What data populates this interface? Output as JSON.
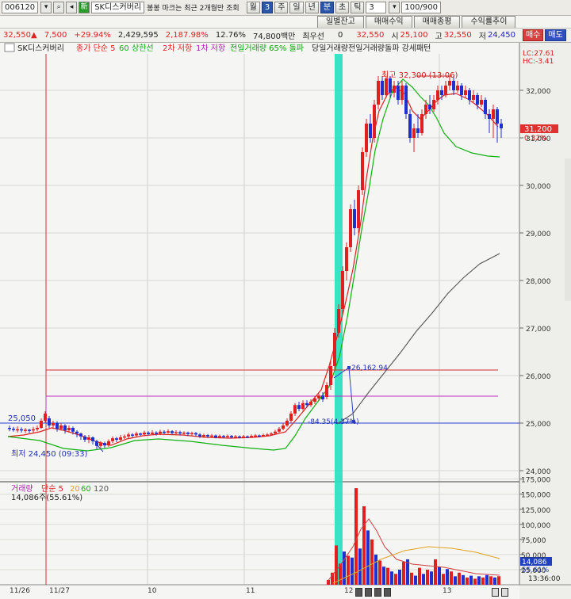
{
  "toolbar1": {
    "code": "006120",
    "name": "SK디스커버리",
    "notice": "봉봉 마크는 최근 2개월만 조회",
    "period_tabs": [
      "월",
      "3",
      "주",
      "일",
      "년",
      "분",
      "초",
      "틱"
    ],
    "active_tab": "분",
    "interval": "3",
    "count": "100/900",
    "tab_buttons": [
      "일별잔고",
      "매매수익",
      "매매종평",
      "수익률추이"
    ]
  },
  "quote_bar": {
    "price": "32,550",
    "change": "7,500",
    "change_pct": "+29.94%",
    "volume": "2,429,595",
    "volume_ratio": "2,187.98%",
    "turnover": "12.76%",
    "amount": "74,800백만",
    "pref_label": "최우선",
    "zero": "0",
    "last": "32,550",
    "open_label": "시",
    "open": "25,100",
    "high_label": "고",
    "high": "32,550",
    "low_label": "저",
    "low": "24,450",
    "buy_label": "매수",
    "sell_label": "매도"
  },
  "legend_bar": {
    "name": "SK디스커버리",
    "ma_label": "종가 단순 5",
    "ma60": "60",
    "upper_limit": "상한선",
    "resist2": "2차 저항",
    "resist1": "1차 저항",
    "prev_vol": "전일거래량 65% 돌파",
    "pattern": "당일거래량전일거래량돌파 강세패턴"
  },
  "price_panel": {
    "lc_label": "LC:27.61",
    "hc_label": "HC:-3.41",
    "y_ticks": [
      "32,000",
      "31,000",
      "30,000",
      "29,000",
      "28,000",
      "27,000",
      "26,000",
      "25,000",
      "24,000"
    ],
    "current_price": "31,200",
    "current_pct": "0.32%",
    "left_value": "25,050",
    "high_annotation": "최고 32,300 (13:06)",
    "low_annotation": "최저 24,450 (09:33)",
    "mid_annotation": "26,162.94",
    "diff_annotation": "-84.35(4.37%)"
  },
  "volume_panel": {
    "legend_title": "거래량",
    "legend_ma": "단순 5",
    "legend_20": "20",
    "legend_60": "60",
    "legend_120": "120",
    "shares": "14,086주(55.61%)",
    "y_ticks": [
      "175,000",
      "150,000",
      "125,000",
      "100,000",
      "75,000",
      "50,000",
      "25,000"
    ],
    "current": "14,086",
    "current_pct": "55.61%"
  },
  "x_axis": {
    "dates": [
      "11/26",
      "11/27",
      "10",
      "11",
      "12",
      "13"
    ],
    "time": "13:36:00"
  },
  "colors": {
    "up": "#e02020",
    "down": "#2030d0",
    "ma5": "#e02020",
    "ma20": "#10b010",
    "ma60": "#555555",
    "vol_ma": "#e0a020",
    "highlight": "#28e0c0"
  }
}
